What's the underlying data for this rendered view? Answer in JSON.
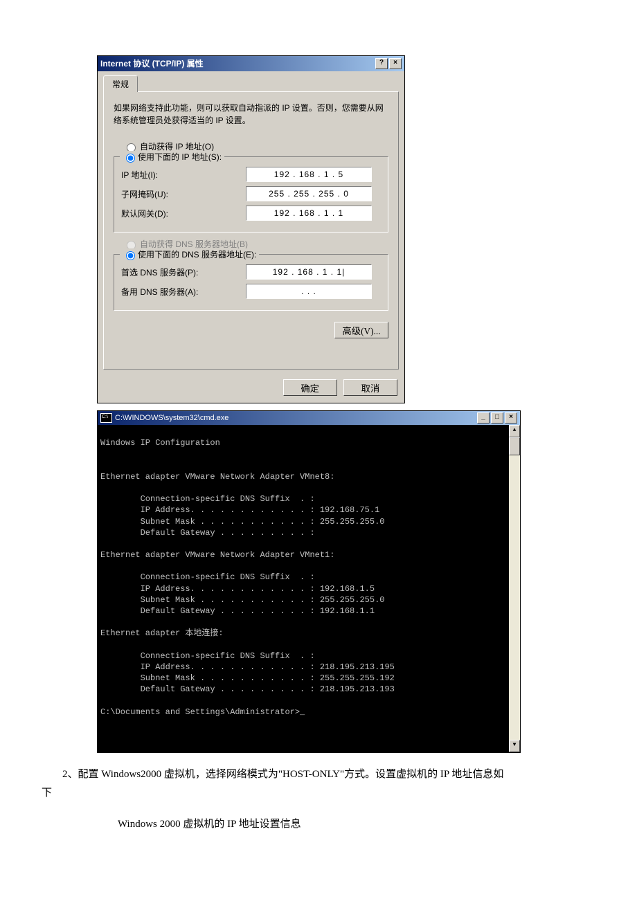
{
  "dialog": {
    "title": "Internet 协议 (TCP/IP) 属性",
    "help_btn": "?",
    "close_btn": "×",
    "tab": "常规",
    "description": "如果网络支持此功能，则可以获取自动指派的 IP 设置。否则，您需要从网络系统管理员处获得适当的 IP 设置。",
    "radio_auto_ip": "自动获得 IP 地址(O)",
    "radio_manual_ip": "使用下面的 IP 地址(S):",
    "ip_label": "IP 地址(I):",
    "ip_value": "192 . 168 .  1  .  5",
    "mask_label": "子网掩码(U):",
    "mask_value": "255 . 255 . 255 .  0",
    "gateway_label": "默认网关(D):",
    "gateway_value": "192 . 168 .  1  .  1",
    "radio_auto_dns": "自动获得 DNS 服务器地址(B)",
    "radio_manual_dns": "使用下面的 DNS 服务器地址(E):",
    "dns1_label": "首选 DNS 服务器(P):",
    "dns1_value": "192 . 168 .  1  .  1|",
    "dns2_label": "备用 DNS 服务器(A):",
    "dns2_value": ".       .       .",
    "advanced_btn": "高级(V)...",
    "ok_btn": "确定",
    "cancel_btn": "取消"
  },
  "cmd": {
    "title": "C:\\WINDOWS\\system32\\cmd.exe",
    "minimize": "_",
    "maximize": "□",
    "close": "×",
    "line_header": "Windows IP Configuration",
    "adapter1_title": "Ethernet adapter VMware Network Adapter VMnet8:",
    "a1_l1": "        Connection-specific DNS Suffix  . :",
    "a1_l2": "        IP Address. . . . . . . . . . . . : 192.168.75.1",
    "a1_l3": "        Subnet Mask . . . . . . . . . . . : 255.255.255.0",
    "a1_l4": "        Default Gateway . . . . . . . . . :",
    "adapter2_title": "Ethernet adapter VMware Network Adapter VMnet1:",
    "a2_l1": "        Connection-specific DNS Suffix  . :",
    "a2_l2": "        IP Address. . . . . . . . . . . . : 192.168.1.5",
    "a2_l3": "        Subnet Mask . . . . . . . . . . . : 255.255.255.0",
    "a2_l4": "        Default Gateway . . . . . . . . . : 192.168.1.1",
    "adapter3_title": "Ethernet adapter 本地连接:",
    "a3_l1": "        Connection-specific DNS Suffix  . :",
    "a3_l2": "        IP Address. . . . . . . . . . . . : 218.195.213.195",
    "a3_l3": "        Subnet Mask . . . . . . . . . . . : 255.255.255.192",
    "a3_l4": "        Default Gateway . . . . . . . . . : 218.195.213.193",
    "prompt": "C:\\Documents and Settings\\Administrator>_"
  },
  "body": {
    "para1": "2、配置 Windows2000 虚拟机，选择网络模式为\"HOST-ONLY\"方式。设置虚拟机的 IP 地址信息如下",
    "para2": "Windows 2000 虚拟机的 IP 地址设置信息"
  }
}
